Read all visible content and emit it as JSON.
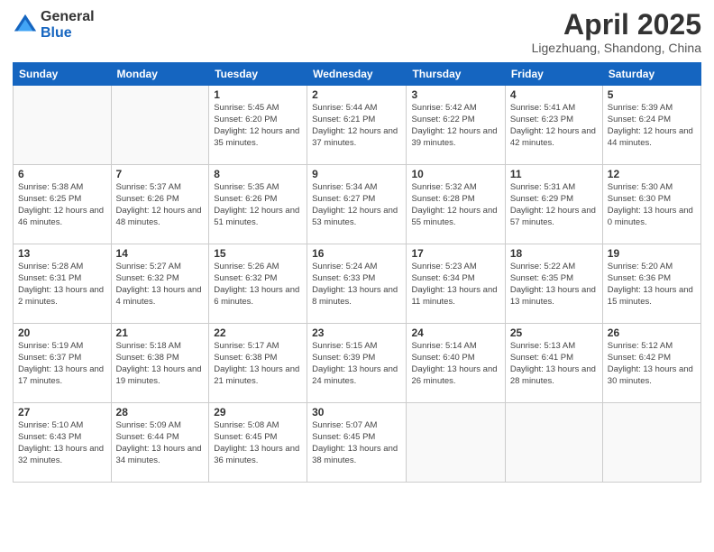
{
  "header": {
    "logo_general": "General",
    "logo_blue": "Blue",
    "month_title": "April 2025",
    "location": "Ligezhuang, Shandong, China"
  },
  "weekdays": [
    "Sunday",
    "Monday",
    "Tuesday",
    "Wednesday",
    "Thursday",
    "Friday",
    "Saturday"
  ],
  "weeks": [
    [
      {
        "day": "",
        "info": ""
      },
      {
        "day": "",
        "info": ""
      },
      {
        "day": "1",
        "info": "Sunrise: 5:45 AM\nSunset: 6:20 PM\nDaylight: 12 hours and 35 minutes."
      },
      {
        "day": "2",
        "info": "Sunrise: 5:44 AM\nSunset: 6:21 PM\nDaylight: 12 hours and 37 minutes."
      },
      {
        "day": "3",
        "info": "Sunrise: 5:42 AM\nSunset: 6:22 PM\nDaylight: 12 hours and 39 minutes."
      },
      {
        "day": "4",
        "info": "Sunrise: 5:41 AM\nSunset: 6:23 PM\nDaylight: 12 hours and 42 minutes."
      },
      {
        "day": "5",
        "info": "Sunrise: 5:39 AM\nSunset: 6:24 PM\nDaylight: 12 hours and 44 minutes."
      }
    ],
    [
      {
        "day": "6",
        "info": "Sunrise: 5:38 AM\nSunset: 6:25 PM\nDaylight: 12 hours and 46 minutes."
      },
      {
        "day": "7",
        "info": "Sunrise: 5:37 AM\nSunset: 6:26 PM\nDaylight: 12 hours and 48 minutes."
      },
      {
        "day": "8",
        "info": "Sunrise: 5:35 AM\nSunset: 6:26 PM\nDaylight: 12 hours and 51 minutes."
      },
      {
        "day": "9",
        "info": "Sunrise: 5:34 AM\nSunset: 6:27 PM\nDaylight: 12 hours and 53 minutes."
      },
      {
        "day": "10",
        "info": "Sunrise: 5:32 AM\nSunset: 6:28 PM\nDaylight: 12 hours and 55 minutes."
      },
      {
        "day": "11",
        "info": "Sunrise: 5:31 AM\nSunset: 6:29 PM\nDaylight: 12 hours and 57 minutes."
      },
      {
        "day": "12",
        "info": "Sunrise: 5:30 AM\nSunset: 6:30 PM\nDaylight: 13 hours and 0 minutes."
      }
    ],
    [
      {
        "day": "13",
        "info": "Sunrise: 5:28 AM\nSunset: 6:31 PM\nDaylight: 13 hours and 2 minutes."
      },
      {
        "day": "14",
        "info": "Sunrise: 5:27 AM\nSunset: 6:32 PM\nDaylight: 13 hours and 4 minutes."
      },
      {
        "day": "15",
        "info": "Sunrise: 5:26 AM\nSunset: 6:32 PM\nDaylight: 13 hours and 6 minutes."
      },
      {
        "day": "16",
        "info": "Sunrise: 5:24 AM\nSunset: 6:33 PM\nDaylight: 13 hours and 8 minutes."
      },
      {
        "day": "17",
        "info": "Sunrise: 5:23 AM\nSunset: 6:34 PM\nDaylight: 13 hours and 11 minutes."
      },
      {
        "day": "18",
        "info": "Sunrise: 5:22 AM\nSunset: 6:35 PM\nDaylight: 13 hours and 13 minutes."
      },
      {
        "day": "19",
        "info": "Sunrise: 5:20 AM\nSunset: 6:36 PM\nDaylight: 13 hours and 15 minutes."
      }
    ],
    [
      {
        "day": "20",
        "info": "Sunrise: 5:19 AM\nSunset: 6:37 PM\nDaylight: 13 hours and 17 minutes."
      },
      {
        "day": "21",
        "info": "Sunrise: 5:18 AM\nSunset: 6:38 PM\nDaylight: 13 hours and 19 minutes."
      },
      {
        "day": "22",
        "info": "Sunrise: 5:17 AM\nSunset: 6:38 PM\nDaylight: 13 hours and 21 minutes."
      },
      {
        "day": "23",
        "info": "Sunrise: 5:15 AM\nSunset: 6:39 PM\nDaylight: 13 hours and 24 minutes."
      },
      {
        "day": "24",
        "info": "Sunrise: 5:14 AM\nSunset: 6:40 PM\nDaylight: 13 hours and 26 minutes."
      },
      {
        "day": "25",
        "info": "Sunrise: 5:13 AM\nSunset: 6:41 PM\nDaylight: 13 hours and 28 minutes."
      },
      {
        "day": "26",
        "info": "Sunrise: 5:12 AM\nSunset: 6:42 PM\nDaylight: 13 hours and 30 minutes."
      }
    ],
    [
      {
        "day": "27",
        "info": "Sunrise: 5:10 AM\nSunset: 6:43 PM\nDaylight: 13 hours and 32 minutes."
      },
      {
        "day": "28",
        "info": "Sunrise: 5:09 AM\nSunset: 6:44 PM\nDaylight: 13 hours and 34 minutes."
      },
      {
        "day": "29",
        "info": "Sunrise: 5:08 AM\nSunset: 6:45 PM\nDaylight: 13 hours and 36 minutes."
      },
      {
        "day": "30",
        "info": "Sunrise: 5:07 AM\nSunset: 6:45 PM\nDaylight: 13 hours and 38 minutes."
      },
      {
        "day": "",
        "info": ""
      },
      {
        "day": "",
        "info": ""
      },
      {
        "day": "",
        "info": ""
      }
    ]
  ]
}
